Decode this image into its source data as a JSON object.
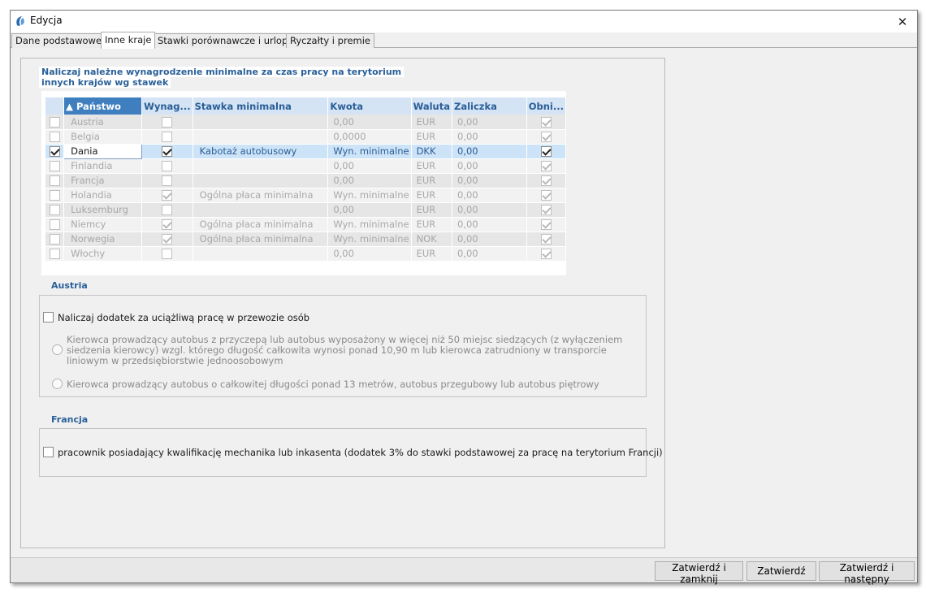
{
  "window": {
    "title": "Edycja",
    "close_glyph": "✕"
  },
  "tabs": [
    {
      "label": "Dane podstawowe"
    },
    {
      "label": "Inne kraje"
    },
    {
      "label": "Stawki porównawcze i urlopy"
    },
    {
      "label": "Ryczałty i premie"
    }
  ],
  "group": {
    "title_line1": "Naliczaj należne wynagrodzenie minimalne za czas pracy na terytorium",
    "title_line2": "innych krajów wg stawek"
  },
  "grid": {
    "columns": {
      "country": "▲ Państwo",
      "wynag": "Wynag...",
      "rate": "Stawka minimalna",
      "amount": "Kwota",
      "currency": "Waluta",
      "advance": "Zaliczka",
      "obni": "Obni..."
    },
    "rows": [
      {
        "selected": false,
        "country": "Austria",
        "wynag": false,
        "rate": "",
        "amount": "0,00",
        "currency": "EUR",
        "advance": "0,00",
        "obni": true
      },
      {
        "selected": false,
        "country": "Belgia",
        "wynag": false,
        "rate": "",
        "amount": "0,0000",
        "currency": "EUR",
        "advance": "0,00",
        "obni": true
      },
      {
        "selected": true,
        "country": "Dania",
        "wynag": true,
        "rate": "Kabotaż autobusowy",
        "amount": "Wyn. minimalne",
        "currency": "DKK",
        "advance": "0,00",
        "obni": true
      },
      {
        "selected": false,
        "country": "Finlandia",
        "wynag": false,
        "rate": "",
        "amount": "0,00",
        "currency": "EUR",
        "advance": "0,00",
        "obni": true
      },
      {
        "selected": false,
        "country": "Francja",
        "wynag": false,
        "rate": "",
        "amount": "0,00",
        "currency": "EUR",
        "advance": "0,00",
        "obni": true
      },
      {
        "selected": false,
        "country": "Holandia",
        "wynag": true,
        "rate": "Ogólna płaca minimalna",
        "amount": "Wyn. minimalne",
        "currency": "EUR",
        "advance": "0,00",
        "obni": true
      },
      {
        "selected": false,
        "country": "Luksemburg",
        "wynag": false,
        "rate": "",
        "amount": "0,00",
        "currency": "EUR",
        "advance": "0,00",
        "obni": true
      },
      {
        "selected": false,
        "country": "Niemcy",
        "wynag": true,
        "rate": "Ogólna płaca minimalna",
        "amount": "Wyn. minimalne",
        "currency": "EUR",
        "advance": "0,00",
        "obni": true
      },
      {
        "selected": false,
        "country": "Norwegia",
        "wynag": true,
        "rate": "Ogólna płaca minimalna",
        "amount": "Wyn. minimalne",
        "currency": "NOK",
        "advance": "0,00",
        "obni": true
      },
      {
        "selected": false,
        "country": "Włochy",
        "wynag": false,
        "rate": "",
        "amount": "0,00",
        "currency": "EUR",
        "advance": "0,00",
        "obni": true
      }
    ]
  },
  "austria": {
    "label": "Austria",
    "checkbox_label": "Naliczaj dodatek za uciążliwą pracę w przewozie osób",
    "checked": false,
    "option1": "Kierowca prowadzący autobus z przyczepą lub autobus wyposażony w więcej niż 50 miejsc siedzących (z wyłączeniem siedzenia kierowcy) wzgl. którego długość całkowita wynosi ponad 10,90 m lub kierowca zatrudniony w transporcie liniowym w przedsiębiorstwie jednoosobowym",
    "option2": "Kierowca prowadzący autobus o całkowitej długości ponad 13 metrów, autobus przegubowy lub autobus piętrowy"
  },
  "francja": {
    "label": "Francja",
    "checkbox_label": "pracownik posiadający kwalifikację mechanika lub inkasenta (dodatek 3% do stawki podstawowej za pracę na terytorium Francji)",
    "checked": false
  },
  "buttons": {
    "confirm_close": "Zatwierdź i zamknij",
    "confirm": "Zatwierdź",
    "confirm_next": "Zatwierdź i następny"
  },
  "icons": {
    "app": "app-logo-icon",
    "close": "close-icon",
    "sort": "sort-ascending-icon"
  }
}
